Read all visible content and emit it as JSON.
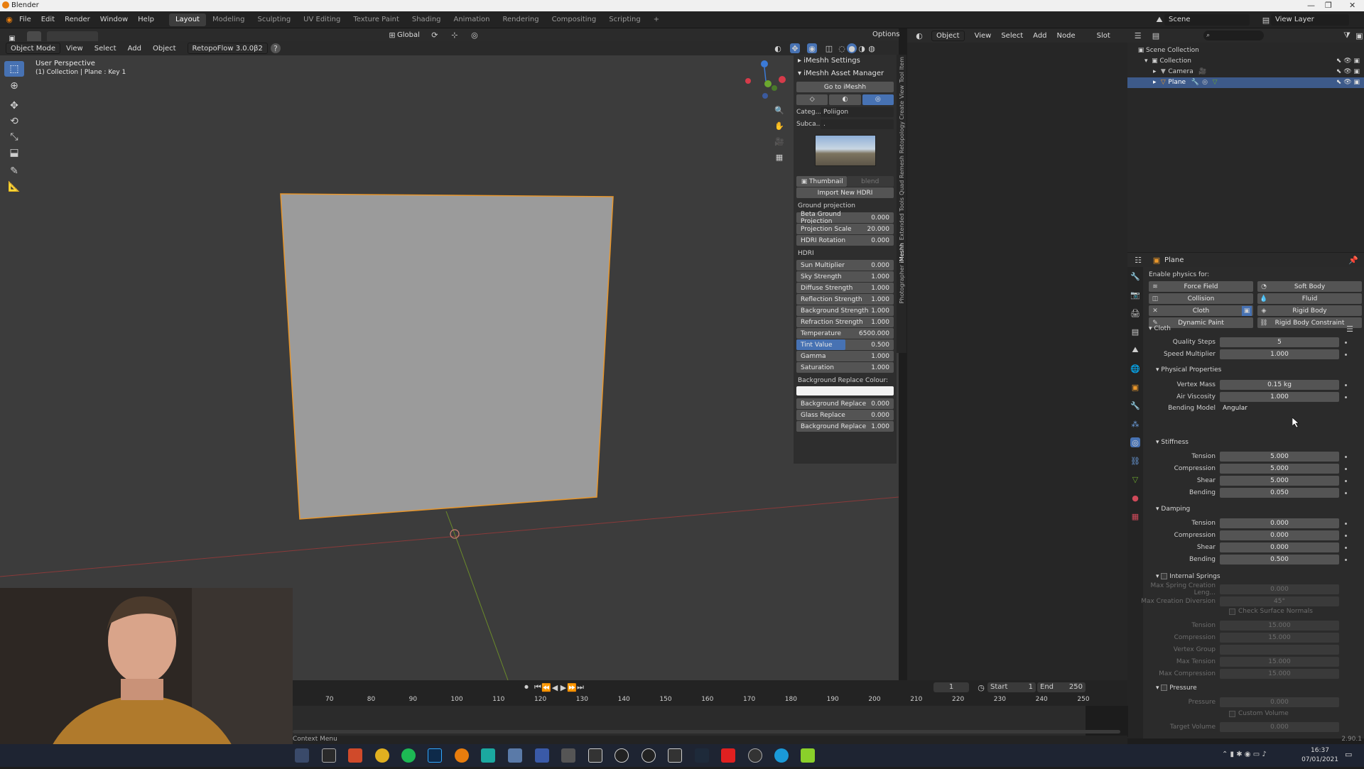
{
  "window": {
    "title": "Blender"
  },
  "menu": {
    "items": [
      "File",
      "Edit",
      "Render",
      "Window",
      "Help"
    ],
    "workspaces": [
      "Layout",
      "Modeling",
      "Sculpting",
      "UV Editing",
      "Texture Paint",
      "Shading",
      "Animation",
      "Rendering",
      "Compositing",
      "Scripting"
    ],
    "active_workspace": "Layout",
    "scene": "Scene",
    "view_layer": "View Layer"
  },
  "viewport": {
    "mode": "Object Mode",
    "menus": [
      "View",
      "Select",
      "Add",
      "Object"
    ],
    "addon": "RetopoFlow 3.0.0β2",
    "orientation": "Global",
    "options": "Options",
    "overlay_title": "User Perspective",
    "overlay_sub": "(1) Collection | Plane : Key 1"
  },
  "npanel": {
    "settings_title": "iMeshh Settings",
    "asset_manager_title": "iMeshh Asset Manager",
    "go_button": "Go to iMeshh",
    "category_label": "Categ...",
    "category_value": "Poliigon",
    "subcategory_label": "Subca...",
    "subcategory_value": ".",
    "thumbnail_label": "Thumbnail",
    "blend_label": "blend",
    "import_button": "Import New HDRI",
    "ground_section": "Ground projection",
    "ground_fields": [
      {
        "label": "Beta Ground Projection",
        "value": "0.000"
      },
      {
        "label": "Projection Scale",
        "value": "20.000"
      },
      {
        "label": "HDRI Rotation",
        "value": "0.000"
      }
    ],
    "hdri_section": "HDRI",
    "hdri_fields": [
      {
        "label": "Sun Multiplier",
        "value": "0.000"
      },
      {
        "label": "Sky Strength",
        "value": "1.000"
      },
      {
        "label": "Diffuse Strength",
        "value": "1.000"
      },
      {
        "label": "Reflection Strength",
        "value": "1.000"
      },
      {
        "label": "Background Strength",
        "value": "1.000"
      },
      {
        "label": "Refraction Strength",
        "value": "1.000"
      },
      {
        "label": "Temperature",
        "value": "6500.000"
      },
      {
        "label": "Tint Value",
        "value": "0.500"
      },
      {
        "label": "Gamma",
        "value": "1.000"
      },
      {
        "label": "Saturation",
        "value": "1.000"
      }
    ],
    "tint_fill": 0.5,
    "bg_colour_label": "Background Replace Colour:",
    "replace_fields": [
      {
        "label": "Background Replace",
        "value": "0.000"
      },
      {
        "label": "Glass Replace",
        "value": "0.000"
      },
      {
        "label": "Background Replace",
        "value": "1.000"
      }
    ],
    "tabs": [
      "Item",
      "Tool",
      "View",
      "Create",
      "Retopology",
      "Quad Remesh",
      "Extended Tools",
      "iMeshh",
      "Photographer"
    ]
  },
  "node_header": {
    "object": "Object",
    "menus": [
      "View",
      "Select",
      "Add",
      "Node"
    ],
    "slot": "Slot"
  },
  "outliner": {
    "items": [
      {
        "label": "Scene Collection",
        "level": 0
      },
      {
        "label": "Collection",
        "level": 1
      },
      {
        "label": "Camera",
        "level": 2
      },
      {
        "label": "Plane",
        "level": 2
      }
    ]
  },
  "properties": {
    "object_name": "Plane",
    "enable_label": "Enable physics for:",
    "physics_buttons": [
      "Force Field",
      "Soft Body",
      "Collision",
      "Fluid",
      "Cloth",
      "Rigid Body",
      "Dynamic Paint",
      "Rigid Body Constraint"
    ],
    "cloth_title": "Cloth",
    "quality_steps": {
      "label": "Quality Steps",
      "value": "5"
    },
    "speed_multiplier": {
      "label": "Speed Multiplier",
      "value": "1.000"
    },
    "physical_title": "Physical Properties",
    "vertex_mass": {
      "label": "Vertex Mass",
      "value": "0.15 kg"
    },
    "air_viscosity": {
      "label": "Air Viscosity",
      "value": "1.000"
    },
    "bending_model": {
      "label": "Bending Model",
      "value": "Angular"
    },
    "stiffness_title": "Stiffness",
    "stiffness": [
      {
        "label": "Tension",
        "value": "5.000"
      },
      {
        "label": "Compression",
        "value": "5.000"
      },
      {
        "label": "Shear",
        "value": "5.000"
      },
      {
        "label": "Bending",
        "value": "0.050"
      }
    ],
    "damping_title": "Damping",
    "damping": [
      {
        "label": "Tension",
        "value": "0.000"
      },
      {
        "label": "Compression",
        "value": "0.000"
      },
      {
        "label": "Shear",
        "value": "0.000"
      },
      {
        "label": "Bending",
        "value": "0.500"
      }
    ],
    "internal_title": "Internal Springs",
    "internal": [
      {
        "label": "Max Spring Creation Leng...",
        "value": "0.000"
      },
      {
        "label": "Max Creation Diversion",
        "value": "45°"
      }
    ],
    "check_normals": "Check Surface Normals",
    "internal2": [
      {
        "label": "Tension",
        "value": "15.000"
      },
      {
        "label": "Compression",
        "value": "15.000"
      },
      {
        "label": "Vertex Group",
        "value": ""
      },
      {
        "label": "Max Tension",
        "value": "15.000"
      },
      {
        "label": "Max Compression",
        "value": "15.000"
      }
    ],
    "pressure_title": "Pressure",
    "pressure": {
      "label": "Pressure",
      "value": "0.000"
    },
    "custom_volume": "Custom Volume",
    "target_volume": {
      "label": "Target Volume",
      "value": "0.000"
    }
  },
  "timeline": {
    "ticks": [
      "70",
      "80",
      "90",
      "100",
      "110",
      "120",
      "130",
      "140",
      "150",
      "160",
      "170",
      "180",
      "190",
      "200",
      "210",
      "220",
      "230",
      "240",
      "250"
    ],
    "current_frame": "1",
    "start_label": "Start",
    "start": "1",
    "end_label": "End",
    "end": "250"
  },
  "status": {
    "left": "Context Menu",
    "version": "2.90.1"
  },
  "taskbar": {
    "time": "16:37",
    "date": "07/01/2021"
  }
}
